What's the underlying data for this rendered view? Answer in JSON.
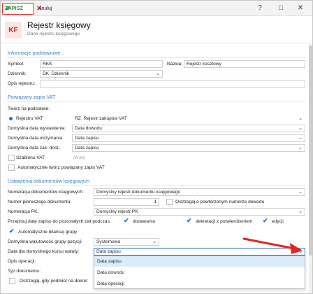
{
  "toolbar": {
    "save_label": "ZAPISZ",
    "cancel_label": "Anuluj"
  },
  "window": {
    "help": "?",
    "minimize": "□",
    "close": "✕"
  },
  "header": {
    "badge": "KF",
    "title": "Rejestr księgowy",
    "subtitle": "Dane rejestru księgowego"
  },
  "basic": {
    "section": "Informacje podstawowe",
    "symbol_label": "Symbol:",
    "symbol_value": "RKK",
    "name_label": "Nazwa:",
    "name_value": "Rejestr kosztowy",
    "journal_label": "Dziennik:",
    "journal_code": "DK",
    "journal_value": "Dziennik",
    "desc_label": "Opis rejestru:",
    "desc_value": ""
  },
  "vat": {
    "section": "Powiązany zapis VAT",
    "create_based": "Twórz na podstawie:",
    "register_label": "Rejestru VAT",
    "register_code": "RZ",
    "register_value": "Rejestr zakupów VAT",
    "issue_label": "Domyślna data wystawienia:",
    "issue_value": "Data dowodu",
    "receive_label": "Domyślna data otrzymania",
    "receive_value": "Data zapisu",
    "deduct_label": "Domyślna data zak. dost.:",
    "deduct_value": "Data zapisu",
    "template_label": "Szablonu VAT",
    "template_placeholder": "(brak)",
    "auto_label": "Automatycznie twórz powiązany zapis VAT"
  },
  "settings": {
    "section": "Ustawienia dokumentów księgowych",
    "numbering_label": "Numeracja dokumentów księgowych:",
    "numbering_value": "Domyślny rejestr dokumentu księgowego",
    "first_number_label": "Numer pierwszego dokumentu:",
    "first_number_value": "1",
    "warn_label": "Ostrzegaj o powtórzonym numerze dowodu",
    "pk_label": "Numeracja PK:",
    "pk_value": "Domyślny rejestr PK",
    "copy_label": "Przepisuj datę zapisu do pozostałych dat podczas:",
    "copy_add": "dodawania",
    "copy_decree": "dekretacji z potwierdzeniem",
    "copy_edit": "edycji",
    "autobalance_label": "Automatyczne bilansuj grupy",
    "currency_group_label": "Domyślna walutowość grupy pozycji:",
    "currency_group_value": "Systemowa",
    "rate_date_label": "Data dla domyślnego kursu waluty:",
    "rate_date_value": "Data zapisu",
    "operation_desc_label": "Opis operacji:",
    "doc_type_label": "Typ dokumentu:",
    "warn_subject_label": "Ostrzegaj, gdy podmiot na dekret"
  },
  "dropdown": {
    "options": [
      "Data zapisu",
      "Data dowodu",
      "Data operacji"
    ],
    "selected": "Data zapisu"
  },
  "colors": {
    "accent": "#3b7fc4",
    "save_border": "#dd3333",
    "arrow": "#e52323",
    "check": "#1f6fbf"
  }
}
